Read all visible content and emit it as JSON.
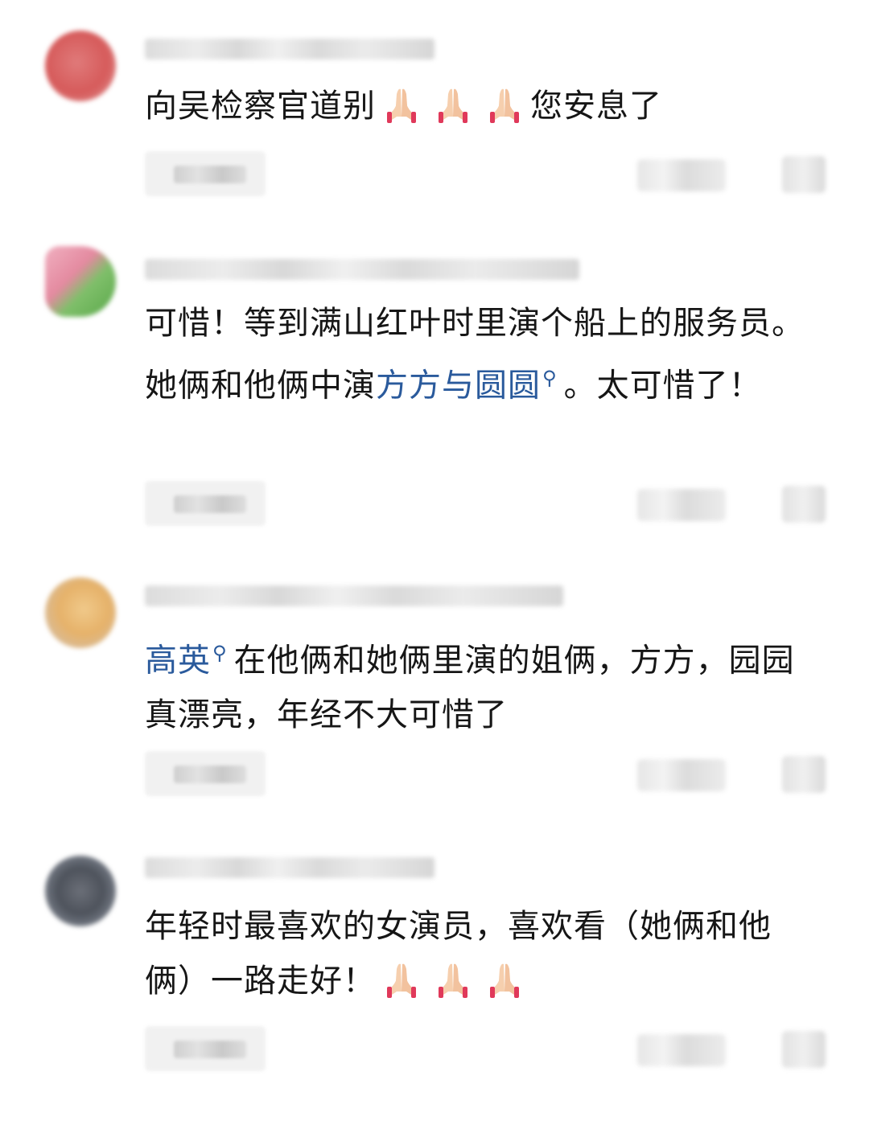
{
  "comments": [
    {
      "text_before": "向吴检察官道别",
      "emoji": [
        "pray-emoji",
        "pray-emoji",
        "pray-emoji"
      ],
      "text_after": "您安息了"
    },
    {
      "text_before": "可惜！等到满山红叶时里演个船上的服务员。她俩和他俩中演",
      "link": "方方与圆圆",
      "text_after": "。太可惜了！"
    },
    {
      "link": "高英",
      "text_after": "在他俩和她俩里演的姐俩，方方，园园真漂亮，年经不大可惜了"
    },
    {
      "text_before": "年轻时最喜欢的女演员，喜欢看（她俩和他俩）一路走好！",
      "emoji": [
        "pray-emoji",
        "pray-emoji",
        "pray-emoji"
      ]
    }
  ],
  "colors": {
    "link": "#2a5a9c",
    "text": "#161616",
    "background": "#ffffff"
  },
  "icons": {
    "link_suffix": "search-icon",
    "emoji": "pray-emoji"
  }
}
